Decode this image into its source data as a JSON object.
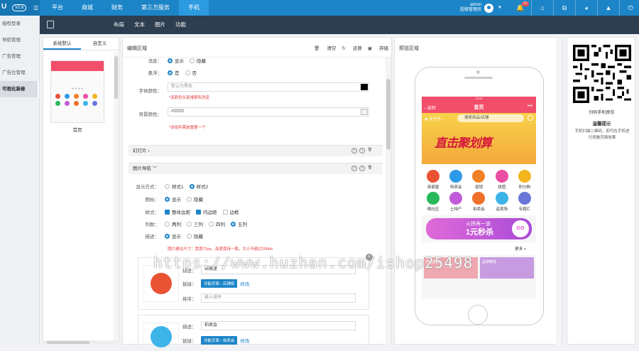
{
  "header": {
    "version": "V2.8",
    "nav": [
      "平台",
      "商城",
      "财务",
      "第三方服务",
      "手机"
    ],
    "active": 4,
    "user_name": "admin",
    "user_role": "超级管理员",
    "badge": "21"
  },
  "subbar": {
    "tabs": [
      "布局",
      "文本",
      "图片",
      "功能"
    ]
  },
  "left_menu": {
    "items": [
      "授权登录",
      "导航管理",
      "广告管理",
      "广告位管理",
      "可视化装修"
    ],
    "active": 4
  },
  "side": {
    "tabs": [
      "系统默认",
      "自定义"
    ],
    "template_label": "首页"
  },
  "editor": {
    "title": "编辑区域",
    "actions": [
      "清空",
      "还原",
      "存储"
    ],
    "msg_label": "消息：",
    "show": "显示",
    "hide": "隐藏",
    "float_label": "悬浮：",
    "yes": "是",
    "no": "否",
    "font_color_label": "字体颜色：",
    "font_color_placeholder": "默认为黑色",
    "font_color_hint": "*该颜色头部搜索所改变",
    "bg_color_label": "背景颜色：",
    "bg_color_value": "#f2f2f2",
    "bg_hint": "*该组件需放置第一个",
    "slide_title": "幻灯片",
    "nav_title": "图片导航",
    "display_label": "显示方式：",
    "style1": "样式1",
    "style2": "样式2",
    "icon_label": "图标：",
    "style_label": "样式：",
    "opt1": "整体边距",
    "opt2": "内边距",
    "opt3": "边框",
    "cols_label": "列数：",
    "cols": [
      "两列",
      "三列",
      "四列",
      "五列"
    ],
    "desc_label": "描述：",
    "size_hint": "图片建议尺寸：宽度72px，高度保持一致，大小不超过200kb",
    "card1": {
      "desc_label": "描述：",
      "desc": "商家屋",
      "link_label": "链接：",
      "link_btn": "功能页面 - 店铺街",
      "modify": "修改",
      "sort_label": "排序：",
      "sort_placeholder": "输入排序"
    },
    "card2": {
      "desc_label": "描述：",
      "desc": "拍卖会",
      "link_label": "链接：",
      "link_btn": "功能页面 - 拍卖会",
      "modify": "修改"
    }
  },
  "preview": {
    "title": "预览区域",
    "time": "21:05",
    "back": "返回",
    "page_title": "首页",
    "location": "定位中...",
    "search": "搜索商品/店铺",
    "banner": "直击聚划算",
    "icons": [
      [
        "商家屋",
        "#e95232"
      ],
      [
        "特卖会",
        "#2c9ae8"
      ],
      [
        "促销",
        "#f08127"
      ],
      [
        "拼团",
        "#e94ea3"
      ],
      [
        "积分购",
        "#f2b51d"
      ],
      [
        "微社区",
        "#27b95a"
      ],
      [
        "土特产",
        "#c05ad8"
      ],
      [
        "拍卖会",
        "#f07029"
      ],
      [
        "返现场",
        "#3db4e8"
      ],
      [
        "专题汇",
        "#6a76d8"
      ]
    ],
    "promo_a": "火拼再一波",
    "promo_b": "1元秒杀",
    "promo_go": "GO",
    "more": "更多 >",
    "cards": [
      "商品精选",
      "品牌精选"
    ]
  },
  "qr": {
    "caption": "扫码手机预览",
    "tip": "温馨提示",
    "desc": "手机扫描二维码，即可在手机进行观看页面效果"
  },
  "watermark": "https://www.huzhan.com/ishop25498"
}
